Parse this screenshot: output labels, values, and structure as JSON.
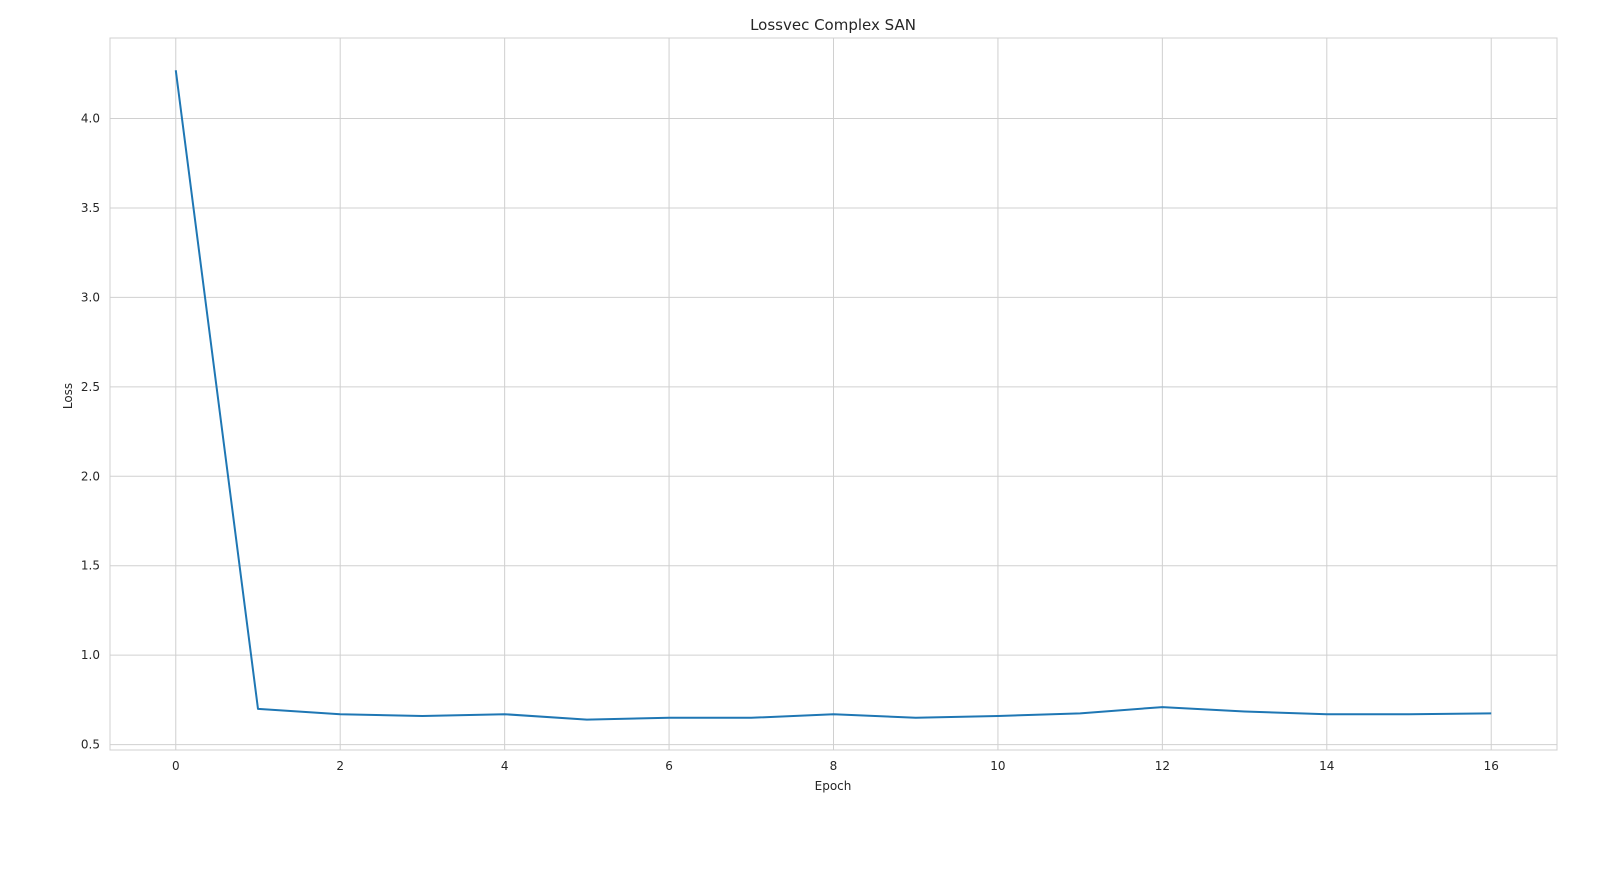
{
  "chart_data": {
    "type": "line",
    "title": "Lossvec Complex SAN",
    "xlabel": "Epoch",
    "ylabel": "Loss",
    "xlim": [
      -0.8,
      16.8
    ],
    "ylim": [
      0.47,
      4.45
    ],
    "xticks": [
      0,
      2,
      4,
      6,
      8,
      10,
      12,
      14,
      16
    ],
    "yticks": [
      0.5,
      1.0,
      1.5,
      2.0,
      2.5,
      3.0,
      3.5,
      4.0
    ],
    "grid": true,
    "legend": "none",
    "series": [
      {
        "color": "#1f77b4",
        "x": [
          0,
          1,
          2,
          3,
          4,
          5,
          6,
          7,
          8,
          9,
          10,
          11,
          12,
          13,
          14,
          15,
          16
        ],
        "values": [
          4.27,
          0.7,
          0.67,
          0.66,
          0.67,
          0.64,
          0.65,
          0.65,
          0.67,
          0.65,
          0.66,
          0.675,
          0.71,
          0.685,
          0.67,
          0.67,
          0.675
        ]
      }
    ]
  }
}
